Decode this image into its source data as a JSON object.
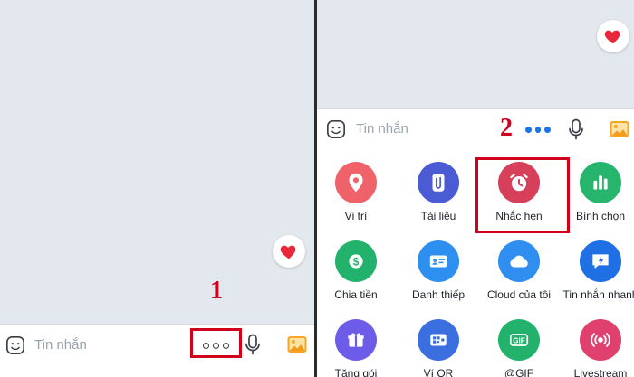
{
  "left_screen": {
    "input_placeholder": "Tin nhắn",
    "step_number": "1"
  },
  "right_screen": {
    "input_placeholder": "Tin nhắn",
    "step_number": "2",
    "tools": [
      {
        "label": "Vị trí",
        "icon": "location-pin-icon",
        "color": "#f0626a"
      },
      {
        "label": "Tài liệu",
        "icon": "paperclip-icon",
        "color": "#4a5bd4"
      },
      {
        "label": "Nhắc hẹn",
        "icon": "alarm-clock-icon",
        "color": "#d6405a"
      },
      {
        "label": "Bình chọn",
        "icon": "bar-chart-icon",
        "color": "#27b46c"
      },
      {
        "label": "Chia tiền",
        "icon": "money-split-icon",
        "color": "#22b26b"
      },
      {
        "label": "Danh thiếp",
        "icon": "business-card-icon",
        "color": "#2d8ff0"
      },
      {
        "label": "Cloud của tôi",
        "icon": "cloud-icon",
        "color": "#2f8ef0"
      },
      {
        "label": "Tin nhắn nhanh",
        "icon": "quick-message-icon",
        "color": "#1f6fe5"
      },
      {
        "label": "Tặng gói",
        "icon": "gift-icon",
        "color": "#6c5ce7"
      },
      {
        "label": "Ví QR",
        "icon": "qr-wallet-icon",
        "color": "#3b6fe0"
      },
      {
        "label": "@GIF",
        "icon": "gif-icon",
        "color": "#22b26b"
      },
      {
        "label": "Livestream",
        "icon": "livestream-icon",
        "color": "#e0406e"
      }
    ]
  },
  "colors": {
    "highlight_red": "#d0021b",
    "heart_red": "#e8283a",
    "more_dots_blue": "#1a73e8",
    "chat_background": "#e3e8ef"
  }
}
